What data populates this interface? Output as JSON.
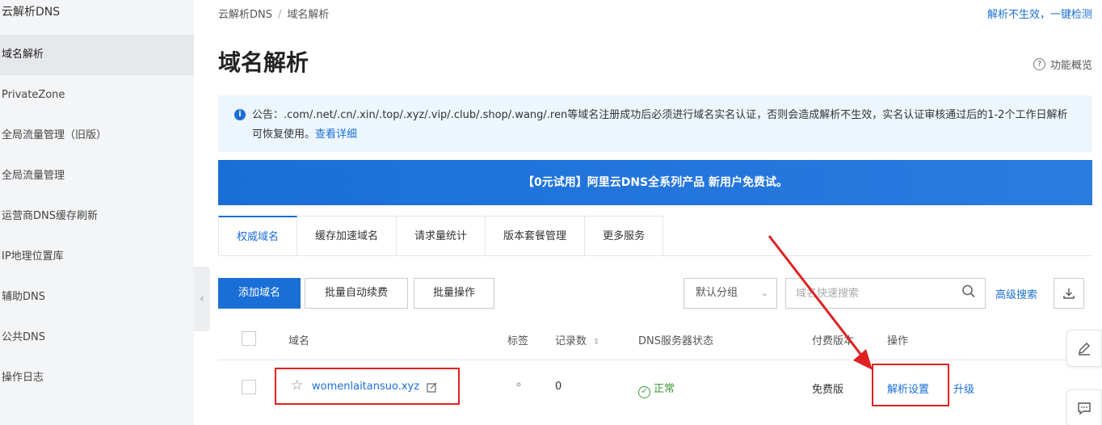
{
  "sidebar": {
    "title": "云解析DNS",
    "items": [
      {
        "label": "域名解析",
        "active": true
      },
      {
        "label": "PrivateZone"
      },
      {
        "label": "全局流量管理（旧版）"
      },
      {
        "label": "全局流量管理"
      },
      {
        "label": "运营商DNS缓存刷新"
      },
      {
        "label": "IP地理位置库"
      },
      {
        "label": "辅助DNS"
      },
      {
        "label": "公共DNS"
      },
      {
        "label": "操作日志"
      }
    ],
    "collapse_icon": "chevron-left-icon"
  },
  "header": {
    "breadcrumb": [
      "云解析DNS",
      "域名解析"
    ],
    "top_right_link": "解析不生效，一键检测",
    "title": "域名解析",
    "overview_link": "功能概览"
  },
  "notice": {
    "text": "公告：.com/.net/.cn/.xin/.top/.xyz/.vip/.club/.shop/.wang/.ren等域名注册成功后必须进行域名实名认证，否则会造成解析不生效，实名认证审核通过后的1-2个工作日解析可恢复使用。",
    "link": "查看详细"
  },
  "banner": {
    "text": "【0元试用】阿里云DNS全系列产品 新用户免费试。"
  },
  "tabs": [
    {
      "label": "权威域名",
      "active": true
    },
    {
      "label": "缓存加速域名"
    },
    {
      "label": "请求量统计"
    },
    {
      "label": "版本套餐管理"
    },
    {
      "label": "更多服务"
    }
  ],
  "toolbar": {
    "add_domain": "添加域名",
    "batch_renew": "批量自动续费",
    "batch_ops": "批量操作",
    "group_select": "默认分组",
    "search_placeholder": "域名快速搜索",
    "advanced_search": "高级搜索"
  },
  "table": {
    "headers": {
      "domain": "域名",
      "tag": "标签",
      "records": "记录数",
      "dns_status": "DNS服务器状态",
      "plan": "付费版本",
      "actions": "操作"
    },
    "rows": [
      {
        "domain": "womenlaitansuo.xyz",
        "records": "0",
        "dns_status": "正常",
        "plan": "免费版",
        "action_primary": "解析设置",
        "action_secondary": "升级"
      }
    ]
  },
  "colors": {
    "accent": "#1a6fd6",
    "annotation_red": "#e02020",
    "status_ok": "#3a9a3a",
    "sidebar_bg": "#f4f5f7",
    "notice_bg": "#edf6fd"
  }
}
